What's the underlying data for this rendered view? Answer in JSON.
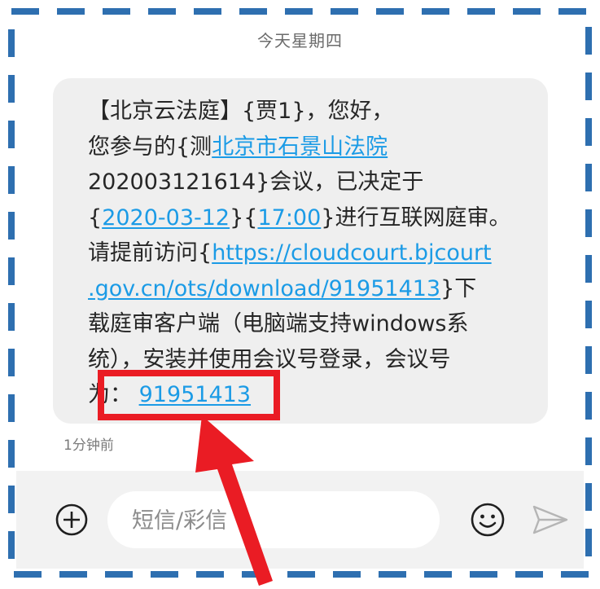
{
  "header": {
    "day": "今天星期四"
  },
  "message": {
    "line1": "【北京云法庭】{贾1}，您好，",
    "line2_pre": "您参与的{测",
    "line2_link": "北京市石景山法院",
    "line3": "202003121614}会议，已决定于",
    "line4_open": "{",
    "line4_date": "2020-03-12",
    "line4_mid": "}{",
    "line4_time": "17:00",
    "line4_post": "}进行互联网庭审。",
    "line5_pre": "请提前访问{",
    "line5_link": "https://cloudcourt.bjcourt",
    "line6_link": ".gov.cn/ots/download/91951413",
    "line6_post": "}下",
    "line7": "载庭审客户端（电脑端支持windows系",
    "line8": "统），安装并使用会议号登录，会议号",
    "line9_pre": "为：",
    "line9_link": "91951413"
  },
  "timestamp": "1分钟前",
  "input": {
    "placeholder": "短信/彩信",
    "value": ""
  },
  "icons": {
    "add": "add-circle-icon",
    "emoji": "smiley-icon",
    "send": "send-icon"
  },
  "colors": {
    "link": "#1b9be6",
    "highlight": "#ea1c24",
    "frame": "#2e6fb0",
    "bubble": "#efefef"
  }
}
